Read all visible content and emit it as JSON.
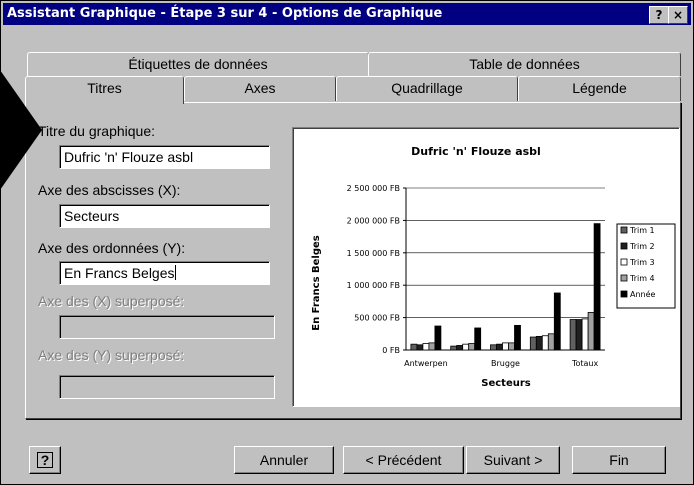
{
  "window": {
    "title": "Assistant Graphique - Étape 3 sur 4 - Options de Graphique",
    "help_label": "?",
    "close_label": "×"
  },
  "tabs": {
    "back": [
      {
        "label": "Étiquettes de données"
      },
      {
        "label": "Table de données"
      }
    ],
    "front": [
      {
        "label": "Titres",
        "active": true
      },
      {
        "label": "Axes"
      },
      {
        "label": "Quadrillage"
      },
      {
        "label": "Légende"
      }
    ]
  },
  "form": {
    "chart_title_label": "Titre du graphique:",
    "chart_title_value": "Dufric 'n' Flouze asbl",
    "x_axis_label": "Axe des abscisses (X):",
    "x_axis_value": "Secteurs",
    "y_axis_label": "Axe des ordonnées (Y):",
    "y_axis_value": "En Francs Belges",
    "x2_axis_label": "Axe des (X)  superposé:",
    "y2_axis_label": "Axe des (Y) superposé:"
  },
  "buttons": {
    "help": "?",
    "cancel": "Annuler",
    "previous": "< Précédent",
    "next": "Suivant >",
    "finish": "Fin"
  },
  "chart_data": {
    "type": "bar",
    "title": "Dufric 'n' Flouze asbl",
    "xlabel": "Secteurs",
    "ylabel": "En Francs Belges",
    "categories": [
      "Antwerpen",
      "Brugge",
      "Totaux"
    ],
    "ylim": [
      0,
      2500000
    ],
    "yticks": [
      {
        "value": 0,
        "label": "0 FB"
      },
      {
        "value": 500000,
        "label": "500 000 FB"
      },
      {
        "value": 1000000,
        "label": "1 000 000 FB"
      },
      {
        "value": 1500000,
        "label": "1 500 000 FB"
      },
      {
        "value": 2000000,
        "label": "2 000 000 FB"
      },
      {
        "value": 2500000,
        "label": "2 500 000 FB"
      }
    ],
    "group_count": 4,
    "series": [
      {
        "name": "Trim 1",
        "values": [
          90000,
          60000,
          80000,
          200000,
          470000
        ],
        "color": "#606060"
      },
      {
        "name": "Trim 2",
        "values": [
          80000,
          70000,
          90000,
          210000,
          470000
        ],
        "color": "#202020"
      },
      {
        "name": "Trim 3",
        "values": [
          100000,
          90000,
          110000,
          220000,
          480000
        ],
        "color": "#ffffff"
      },
      {
        "name": "Trim 4",
        "values": [
          110000,
          100000,
          110000,
          250000,
          580000
        ],
        "color": "#a0a0a0"
      },
      {
        "name": "Année",
        "values": [
          370000,
          340000,
          380000,
          880000,
          1950000
        ],
        "color": "#000000"
      }
    ],
    "legend_position": "right",
    "grid": true
  }
}
